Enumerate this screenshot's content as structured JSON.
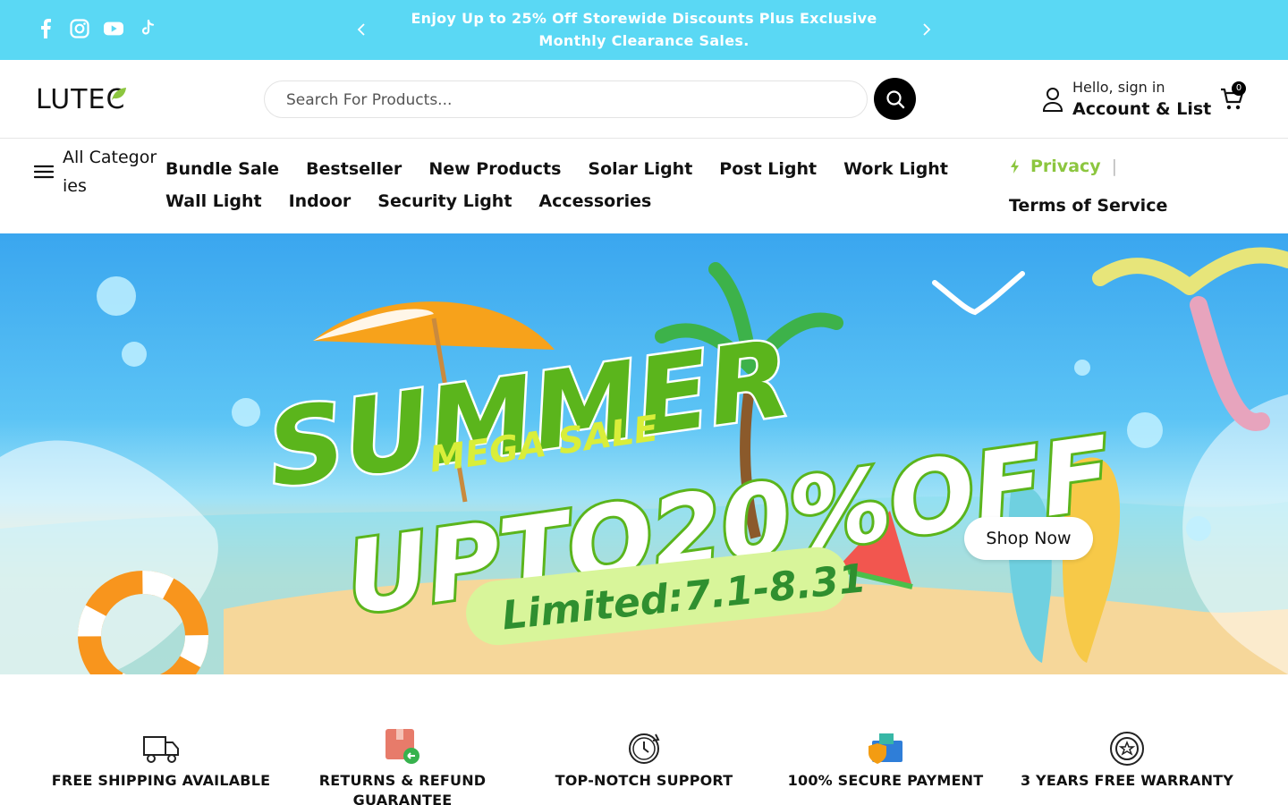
{
  "announcement": {
    "social_icons": [
      "facebook-icon",
      "instagram-icon",
      "youtube-icon",
      "tiktok-icon"
    ],
    "text": "Enjoy Up to 25% Off Storewide Discounts Plus Exclusive Monthly Clearance Sales.",
    "background": "#5ad8f4"
  },
  "header": {
    "logo": "LUTEC",
    "search": {
      "placeholder": "Search For Products..."
    },
    "account": {
      "greeting": "Hello, sign in",
      "label": "Account & List"
    },
    "cart": {
      "count": "0"
    }
  },
  "nav": {
    "all_categories": "All Categories",
    "items": [
      {
        "label": "Bundle Sale"
      },
      {
        "label": "Bestseller"
      },
      {
        "label": "New Products"
      },
      {
        "label": "Solar Light"
      },
      {
        "label": "Post Light"
      },
      {
        "label": "Work Light"
      },
      {
        "label": "Wall Light"
      },
      {
        "label": "Indoor"
      },
      {
        "label": "Security Light"
      },
      {
        "label": "Accessories"
      }
    ],
    "privacy": "Privacy",
    "terms": "Terms of Service",
    "accent_color": "#8cc63f"
  },
  "hero": {
    "headline": "SUMMER",
    "subheadline": "MEGA SALE",
    "offer": "UPTO20%OFF",
    "dates": "Limited:7.1-8.31",
    "cta": "Shop Now"
  },
  "features": [
    {
      "label": "FREE SHIPPING AVAILABLE",
      "icon": "truck-icon"
    },
    {
      "label": "RETURNS & REFUND GUARANTEE",
      "icon": "return-box-icon"
    },
    {
      "label": "TOP-NOTCH SUPPORT",
      "icon": "support-clock-icon"
    },
    {
      "label": "100% SECURE PAYMENT",
      "icon": "secure-payment-icon"
    },
    {
      "label": "3 YEARS FREE WARRANTY",
      "icon": "warranty-badge-icon"
    }
  ]
}
